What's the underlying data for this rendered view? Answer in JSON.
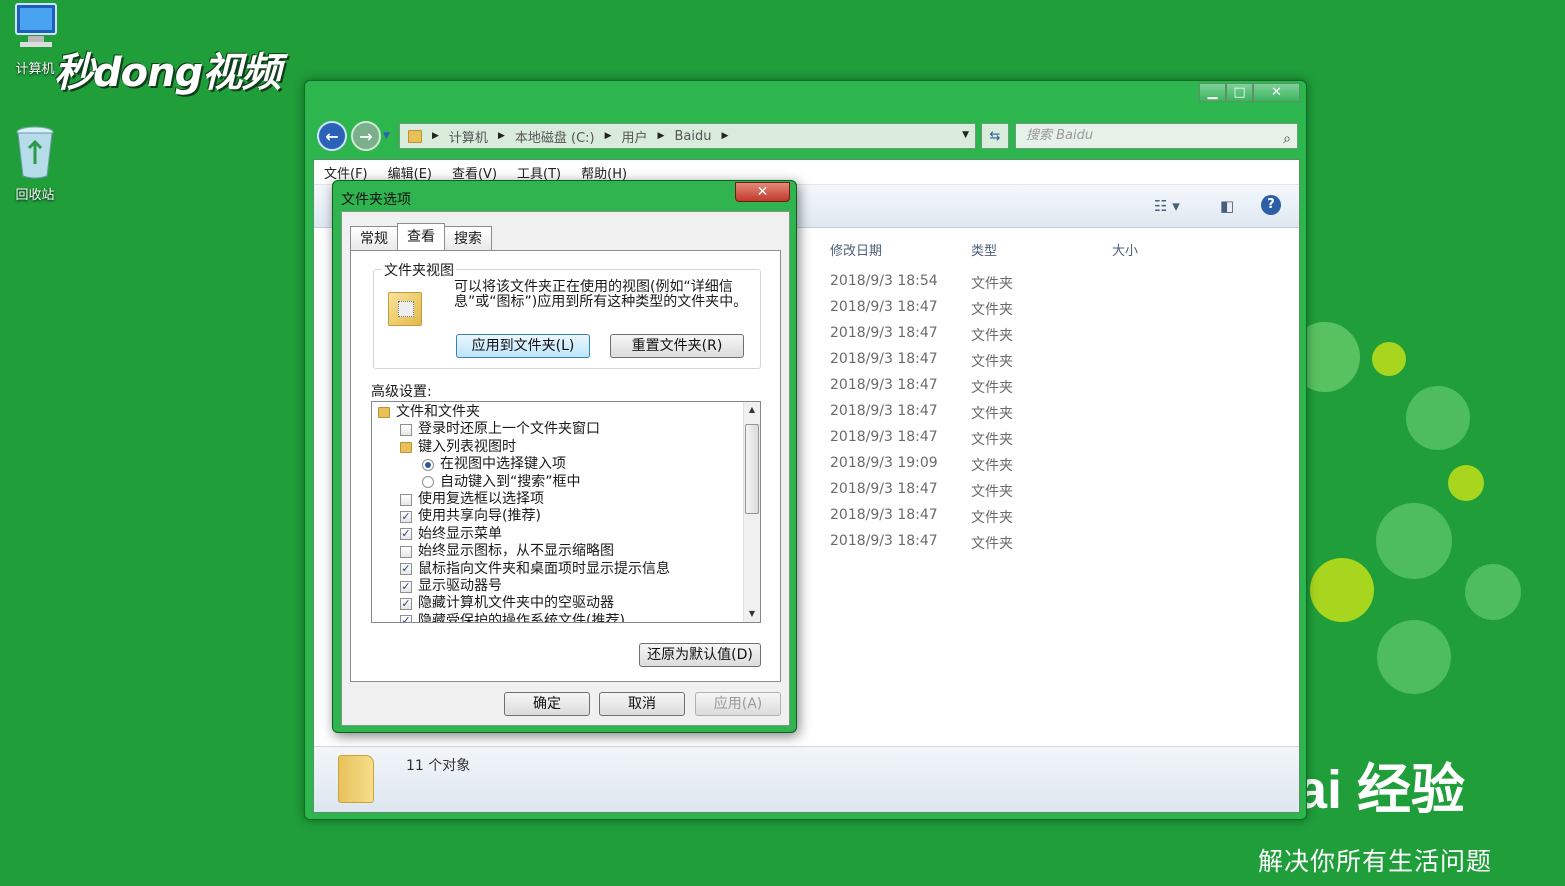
{
  "desktop": {
    "icons": [
      {
        "label": "计算机"
      },
      {
        "label": "回收站"
      }
    ],
    "watermark_top": "秒dong视频",
    "watermark_baidu": "Bai 经验",
    "watermark_slogan": "解决你所有生活问题"
  },
  "explorer": {
    "address": {
      "segments": [
        "计算机",
        "本地磁盘 (C:)",
        "用户",
        "Baidu"
      ]
    },
    "search_placeholder": "搜索 Baidu",
    "menu": [
      "文件(F)",
      "编辑(E)",
      "查看(V)",
      "工具(T)",
      "帮助(H)"
    ],
    "columns": {
      "date": "修改日期",
      "type": "类型",
      "size": "大小"
    },
    "rows": [
      {
        "date": "2018/9/3 18:54",
        "type": "文件夹"
      },
      {
        "date": "2018/9/3 18:47",
        "type": "文件夹"
      },
      {
        "date": "2018/9/3 18:47",
        "type": "文件夹"
      },
      {
        "date": "2018/9/3 18:47",
        "type": "文件夹"
      },
      {
        "date": "2018/9/3 18:47",
        "type": "文件夹"
      },
      {
        "date": "2018/9/3 18:47",
        "type": "文件夹"
      },
      {
        "date": "2018/9/3 18:47",
        "type": "文件夹"
      },
      {
        "date": "2018/9/3 19:09",
        "type": "文件夹"
      },
      {
        "date": "2018/9/3 18:47",
        "type": "文件夹"
      },
      {
        "date": "2018/9/3 18:47",
        "type": "文件夹"
      },
      {
        "date": "2018/9/3 18:47",
        "type": "文件夹"
      }
    ],
    "status": "11 个对象"
  },
  "dialog": {
    "title": "文件夹选项",
    "tabs": [
      "常规",
      "查看",
      "搜索"
    ],
    "active_tab": "查看",
    "folder_view": {
      "legend": "文件夹视图",
      "description": "可以将该文件夹正在使用的视图(例如“详细信息”或“图标”)应用到所有这种类型的文件夹中。",
      "apply_button": "应用到文件夹(L)",
      "reset_button": "重置文件夹(R)"
    },
    "advanced_label": "高级设置:",
    "tree": [
      {
        "kind": "folder",
        "label": "文件和文件夹",
        "level": 0
      },
      {
        "kind": "checkbox",
        "label": "登录时还原上一个文件夹窗口",
        "level": 1,
        "checked": false
      },
      {
        "kind": "folder",
        "label": "键入列表视图时",
        "level": 1
      },
      {
        "kind": "radio",
        "label": "在视图中选择键入项",
        "level": 2,
        "checked": true
      },
      {
        "kind": "radio",
        "label": "自动键入到“搜索”框中",
        "level": 2,
        "checked": false
      },
      {
        "kind": "checkbox",
        "label": "使用复选框以选择项",
        "level": 1,
        "checked": false
      },
      {
        "kind": "checkbox",
        "label": "使用共享向导(推荐)",
        "level": 1,
        "checked": true
      },
      {
        "kind": "checkbox",
        "label": "始终显示菜单",
        "level": 1,
        "checked": true
      },
      {
        "kind": "checkbox",
        "label": "始终显示图标，从不显示缩略图",
        "level": 1,
        "checked": false
      },
      {
        "kind": "checkbox",
        "label": "鼠标指向文件夹和桌面项时显示提示信息",
        "level": 1,
        "checked": true
      },
      {
        "kind": "checkbox",
        "label": "显示驱动器号",
        "level": 1,
        "checked": true
      },
      {
        "kind": "checkbox",
        "label": "隐藏计算机文件夹中的空驱动器",
        "level": 1,
        "checked": true
      },
      {
        "kind": "checkbox",
        "label": "隐藏受保护的操作系统文件(推荐)",
        "level": 1,
        "checked": true
      }
    ],
    "restore_button": "还原为默认值(D)",
    "ok_button": "确定",
    "cancel_button": "取消",
    "apply_button": "应用(A)"
  },
  "colors": {
    "desktop_bg": "#1f9e3a",
    "window_frame": "#2eb64e",
    "close_red": "#c0392b"
  }
}
